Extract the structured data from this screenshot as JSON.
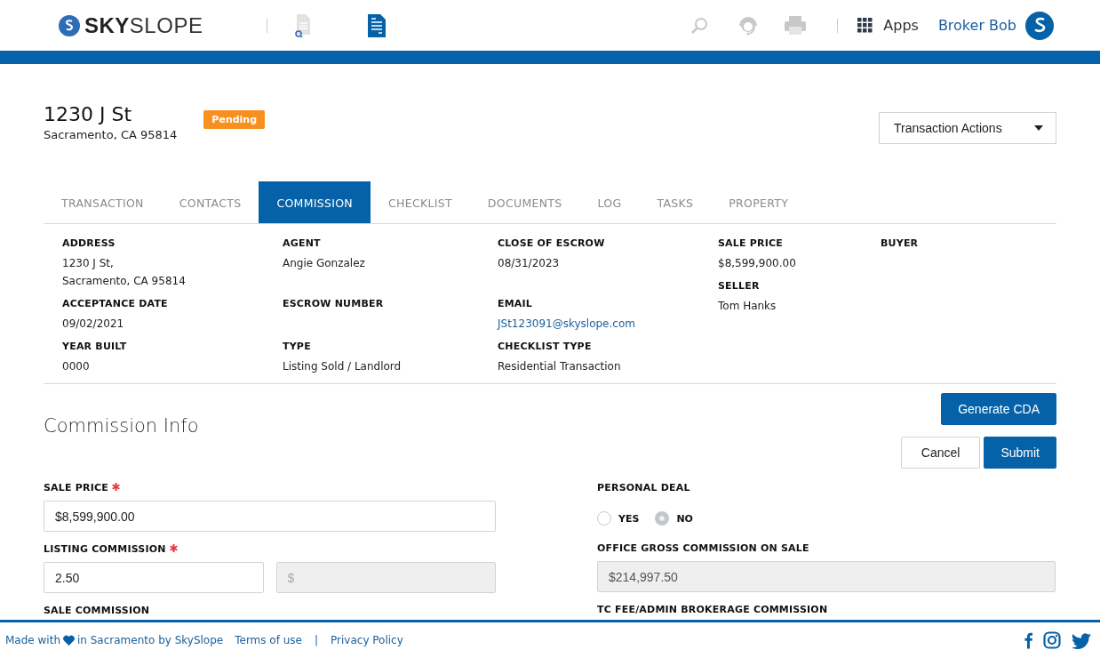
{
  "header": {
    "logo": "**SKY**SLOPE",
    "apps_label": "Apps",
    "user_name": "Broker Bob"
  },
  "property": {
    "title": "1230 J St",
    "subtitle": "Sacramento, CA 95814",
    "status": "Pending",
    "actions_label": "Transaction Actions"
  },
  "tabs": [
    {
      "label": "TRANSACTION",
      "selected": false
    },
    {
      "label": "CONTACTS",
      "selected": false
    },
    {
      "label": "COMMISSION",
      "selected": true
    },
    {
      "label": "CHECKLIST",
      "selected": false
    },
    {
      "label": "DOCUMENTS",
      "selected": false
    },
    {
      "label": "LOG",
      "selected": false
    },
    {
      "label": "TASKS",
      "selected": false
    },
    {
      "label": "PROPERTY",
      "selected": false
    }
  ],
  "details": {
    "grid": [
      [
        {
          "label": "ADDRESS",
          "link": false,
          "lines": [
            "1230 J St,",
            "Sacramento, CA 95814"
          ]
        },
        {
          "label": "AGENT",
          "link": false,
          "lines": [
            "Angie Gonzalez"
          ]
        },
        {
          "label": "CLOSE OF ESCROW",
          "link": false,
          "lines": [
            "08/31/2023"
          ]
        }
      ],
      [
        {
          "label": "ACCEPTANCE DATE",
          "link": false,
          "lines": [
            "09/02/2021"
          ]
        },
        {
          "label": "ESCROW NUMBER"
        },
        {
          "label": "EMAIL",
          "link": true,
          "lines": [
            "JSt123091@skyslope.com"
          ]
        }
      ],
      [
        {
          "label": "YEAR BUILT",
          "link": false,
          "lines": [
            "0000"
          ]
        },
        {
          "label": "TYPE",
          "link": false,
          "lines": [
            "Listing Sold / Landlord"
          ]
        },
        {
          "label": "CHECKLIST TYPE",
          "link": false,
          "lines": [
            "Residential Transaction"
          ]
        }
      ]
    ],
    "side": [
      [
        {
          "label": "SALE PRICE",
          "link": false,
          "lines": [
            "$8,599,900.00"
          ]
        },
        {
          "label": "SELLER",
          "link": false,
          "lines": [
            "Tom Hanks"
          ]
        }
      ],
      [
        {
          "label": "BUYER"
        }
      ]
    ]
  },
  "commission": {
    "title": "Commission Info",
    "generate_label": "Generate CDA",
    "cancel_label": "Cancel",
    "submit_label": "Submit",
    "left": [
      {
        "kind": "inputs",
        "label": "SALE PRICE",
        "required": true,
        "inputs": [
          {
            "value": "$8,599,900.00",
            "disabled": false
          }
        ]
      },
      {
        "kind": "inputs",
        "label": "LISTING COMMISSION",
        "required": true,
        "inputs": [
          {
            "value": "2.50",
            "disabled": false
          },
          {
            "placeholder": "$",
            "disabled": true
          }
        ]
      },
      {
        "kind": "label",
        "label": "SALE COMMISSION",
        "required": false
      }
    ],
    "right": [
      {
        "kind": "radios",
        "label": "PERSONAL DEAL",
        "required": false,
        "options": [
          {
            "label": "YES",
            "selected": false
          },
          {
            "label": "NO",
            "selected": true
          }
        ]
      },
      {
        "kind": "inputs",
        "label": "OFFICE GROSS COMMISSION ON SALE",
        "required": false,
        "inputs": [
          {
            "value": "$214,997.50",
            "disabled": true
          }
        ]
      },
      {
        "kind": "label",
        "label": "TC FEE/ADMIN BROKERAGE COMMISSION",
        "required": false
      }
    ]
  },
  "footer": {
    "credit_before": "Made with",
    "credit_after": "in Sacramento by SkySlope",
    "links": [
      "Terms of use",
      "Privacy Policy"
    ],
    "separator": "|"
  }
}
